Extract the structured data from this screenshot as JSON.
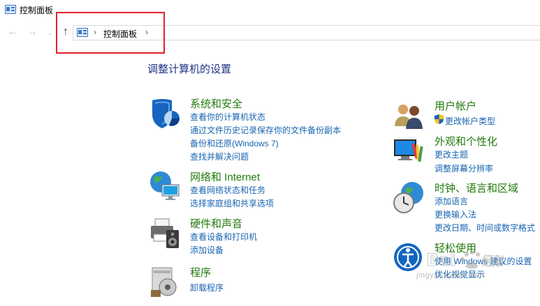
{
  "window": {
    "title": "控制面板"
  },
  "nav": {
    "back": "←",
    "forward": "→",
    "recent": "⌄",
    "up": "↑"
  },
  "address": {
    "sep": "›",
    "crumb": "控制面板"
  },
  "heading": "调整计算机的设置",
  "categories": {
    "security": {
      "title": "系统和安全",
      "links": [
        "查看你的计算机状态",
        "通过文件历史记录保存你的文件备份副本",
        "备份和还原(Windows 7)",
        "查找并解决问题"
      ]
    },
    "network": {
      "title": "网络和 Internet",
      "links": [
        "查看网络状态和任务",
        "选择家庭组和共享选项"
      ]
    },
    "hardware": {
      "title": "硬件和声音",
      "links": [
        "查看设备和打印机",
        "添加设备"
      ]
    },
    "programs": {
      "title": "程序",
      "links": [
        "卸载程序"
      ]
    },
    "users": {
      "title": "用户帐户",
      "links": [
        "更改帐户类型"
      ]
    },
    "appearance": {
      "title": "外观和个性化",
      "links": [
        "更改主题",
        "调整屏幕分辨率"
      ]
    },
    "clock": {
      "title": "时钟、语言和区域",
      "links": [
        "添加语言",
        "更换输入法",
        "更改日期、时间或数字格式"
      ]
    },
    "ease": {
      "title": "轻松使用",
      "links": [
        "使用 Windows 建议的设置",
        "优化视觉显示"
      ]
    }
  },
  "watermark": {
    "text": "jingyan.baidu.com"
  },
  "colors": {
    "highlight": "#e5202b",
    "heading": "#1e3287",
    "category_title": "#217b0c",
    "link": "#1765b2"
  }
}
